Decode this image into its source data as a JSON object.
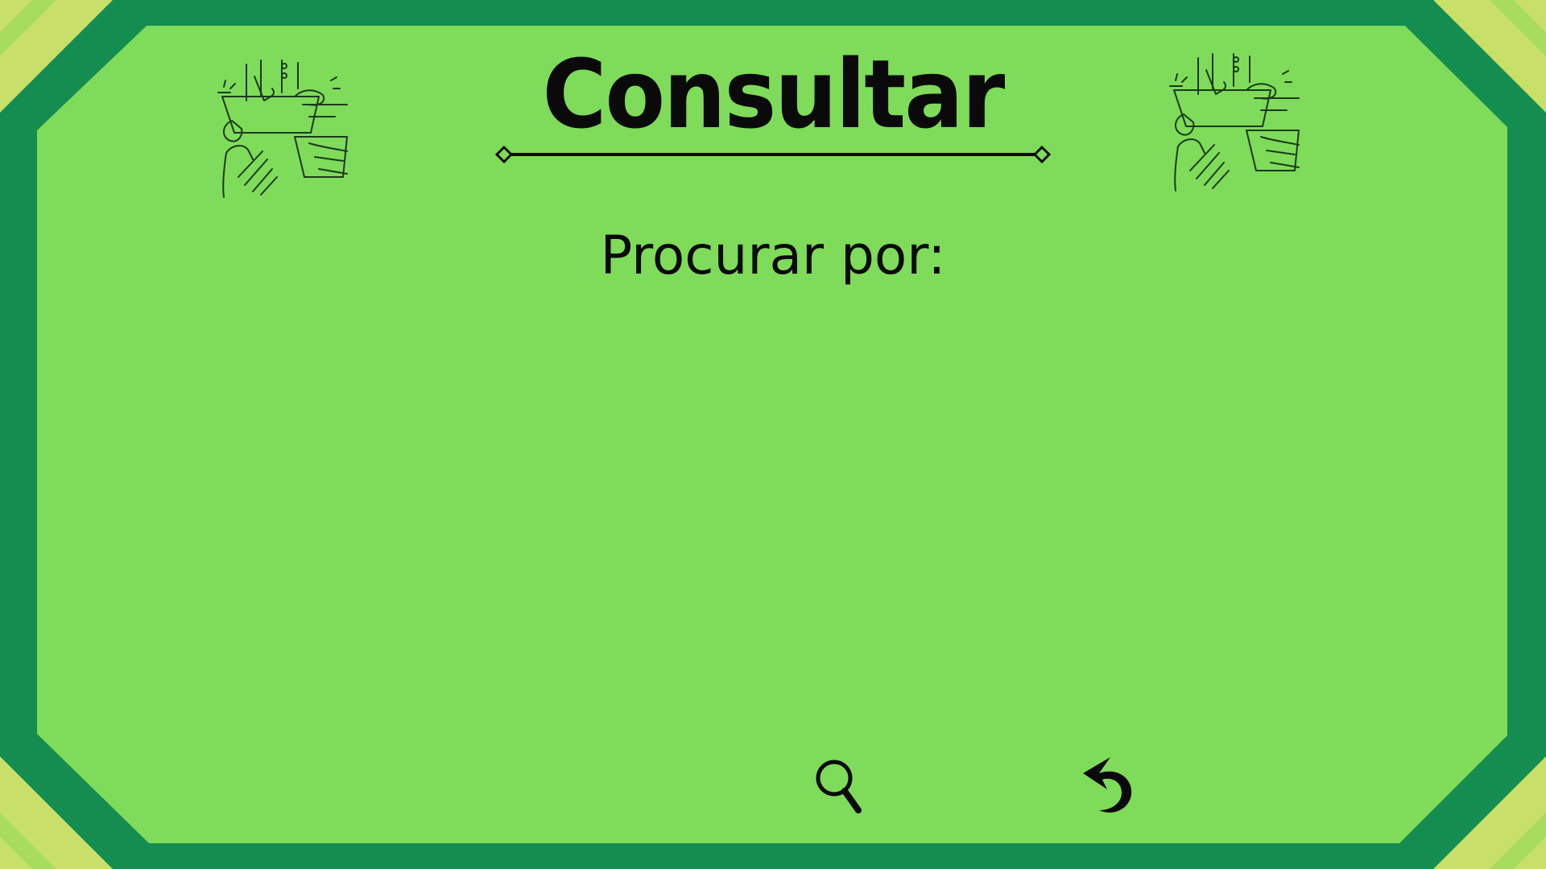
{
  "page": {
    "title": "Consultar",
    "subtitle": "Procurar por:"
  },
  "icons": {
    "left_decoration": "hands-collaboration-icon",
    "right_decoration": "hands-collaboration-icon",
    "search": "search-icon",
    "back": "back-arrow-icon"
  },
  "colors": {
    "background_inner": "#7fdb5a",
    "frame": "#158c50",
    "corner_accent": "#c8e06a",
    "text": "#0a0a0a"
  }
}
